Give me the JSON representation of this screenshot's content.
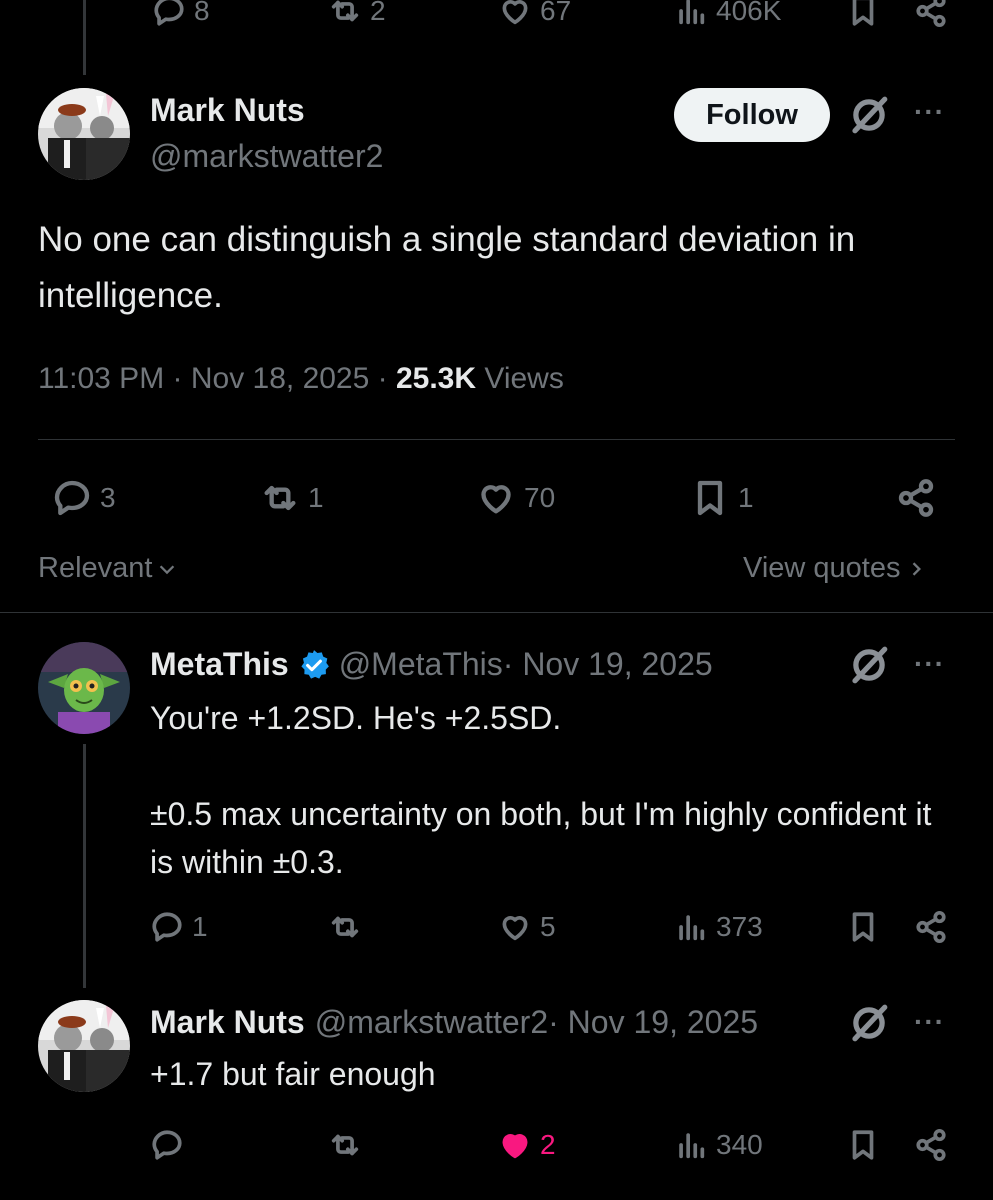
{
  "top_actions": {
    "replies": "8",
    "reposts": "2",
    "likes": "67",
    "views": "406K"
  },
  "main_post": {
    "author_name": "Mark Nuts",
    "handle": "@markstwatter2",
    "follow_label": "Follow",
    "more_label": "···",
    "text": "No one can distinguish a single standard deviation in intelligence.",
    "timestamp": "11:03 PM · Nov 18, 2025 · ",
    "views_count": "25.3K",
    "views_label": " Views",
    "actions": {
      "replies": "3",
      "reposts": "1",
      "likes": "70",
      "bookmarks": "1"
    },
    "sort_label": "Relevant",
    "view_quotes_label": "View quotes"
  },
  "replies": [
    {
      "author_name": "MetaThis",
      "verified": true,
      "handle": "@MetaThis",
      "date": " · Nov 19, 2025",
      "more_label": "···",
      "text": "You're +1.2SD. He's +2.5SD.\n\n±0.5 max uncertainty on both, but I'm highly confident it is within ±0.3.",
      "actions": {
        "replies": "1",
        "reposts": "",
        "likes": "5",
        "views": "373"
      }
    },
    {
      "author_name": "Mark Nuts",
      "verified": false,
      "handle": "@markstwatter2",
      "date": " · Nov 19, 2025",
      "more_label": "···",
      "text": "+1.7 but fair enough",
      "actions": {
        "replies": "",
        "reposts": "",
        "likes": "2",
        "liked": true,
        "views": "340"
      }
    }
  ],
  "colors": {
    "background": "#000000",
    "text": "#e7e9ea",
    "muted": "#71767b",
    "like_active": "#f91880",
    "verified": "#1d9bf0",
    "follow_bg": "#eff3f4"
  }
}
